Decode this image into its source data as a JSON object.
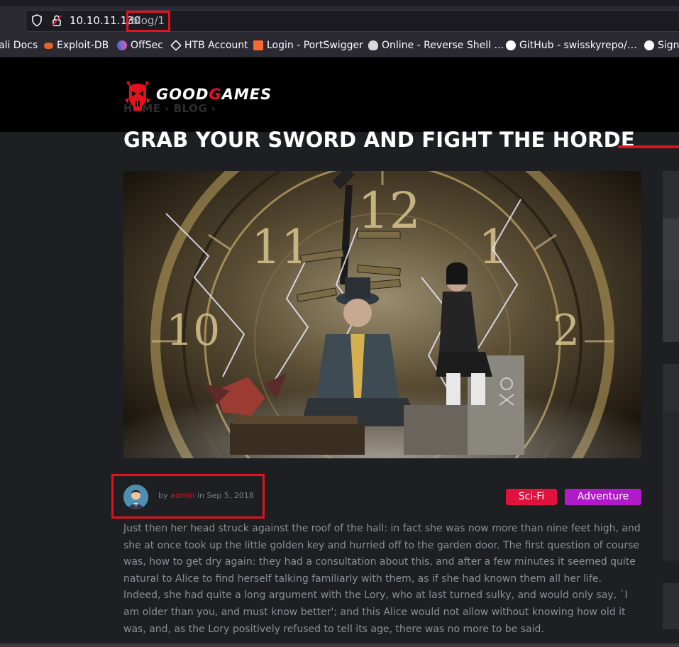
{
  "browser": {
    "url_host": "10.10.11.130",
    "url_path": "/blog/1",
    "bookmarks": [
      {
        "label": "ali Docs",
        "icon": "kali-icon"
      },
      {
        "label": "Exploit-DB",
        "icon": "exploitdb-icon"
      },
      {
        "label": "OffSec",
        "icon": "offsec-icon"
      },
      {
        "label": "HTB Account",
        "icon": "htb-icon"
      },
      {
        "label": "Login - PortSwigger",
        "icon": "portswigger-icon"
      },
      {
        "label": "Online - Reverse Shell …",
        "icon": "skull-icon"
      },
      {
        "label": "GitHub - swisskyrepo/…",
        "icon": "github-icon"
      },
      {
        "label": "Sign",
        "icon": "github-icon"
      }
    ]
  },
  "site": {
    "logo_part1": "GOOD",
    "logo_part2": "G",
    "logo_part3": "AMES",
    "breadcrumb": "HOME  ›  BLOG  ›"
  },
  "post": {
    "title": "GRAB YOUR SWORD AND FIGHT THE HORDE",
    "by": "by ",
    "author": "admin",
    "in_date": " in Sep 5, 2018",
    "tags": [
      "Sci-Fi",
      "Adventure"
    ],
    "body": "Just then her head struck against the roof of the hall: in fact she was now more than nine feet high, and she at once took up the little golden key and hurried off to the garden door. The first question of course was, how to get dry again: they had a consultation about this, and after a few minutes it seemed quite natural to Alice to find herself talking familiarly with them, as if she had known them all her life. Indeed, she had quite a long argument with the Lory, who at last turned sulky, and would only say, `I am older than you, and must know better'; and this Alice would not allow without knowing how old it was, and, as the Lory positively refused to tell its age, there was no more to be said."
  },
  "colors": {
    "accent": "#e3121d",
    "scifi_tag": "#e0123e",
    "adventure_tag": "#b119c9"
  }
}
